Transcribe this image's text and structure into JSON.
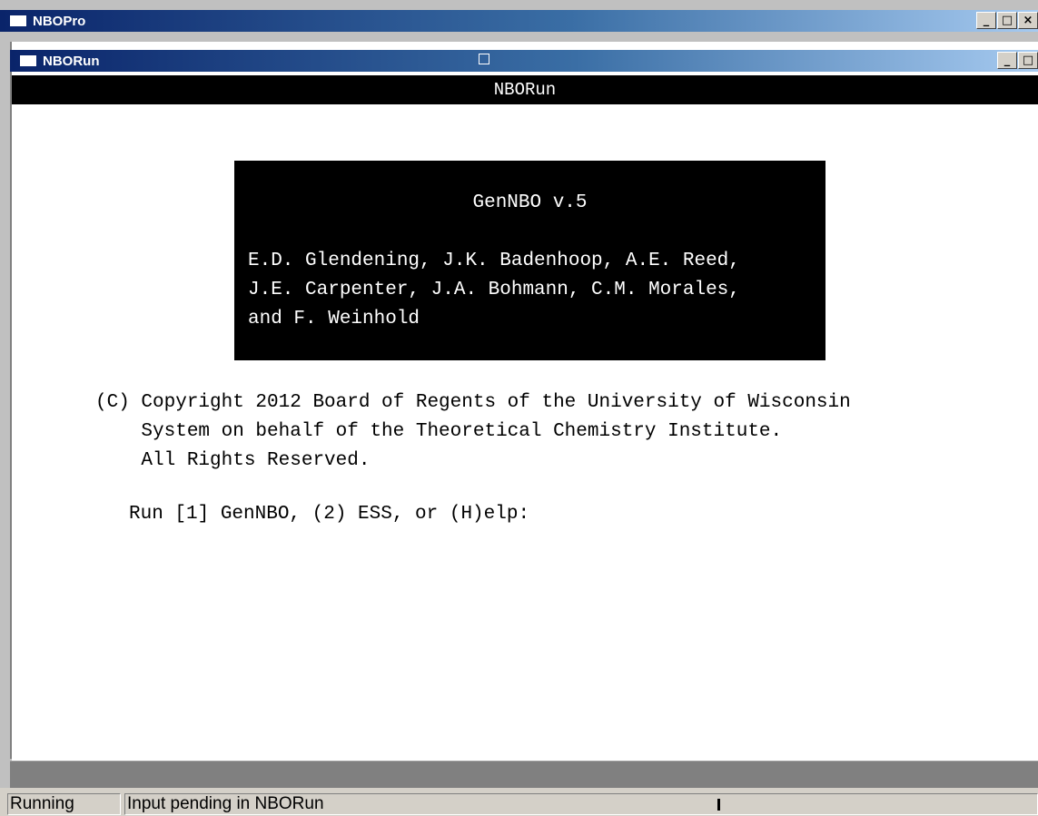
{
  "outer_window": {
    "title": "NBOPro",
    "buttons": [
      "_",
      "□",
      "×"
    ]
  },
  "inner_window": {
    "title": "NBORun",
    "buttons": [
      "_",
      "□"
    ]
  },
  "header": {
    "title": "NBORun"
  },
  "console": {
    "banner": {
      "version": "GenNBO v.5",
      "authors": "E.D. Glendening, J.K. Badenhoop, A.E. Reed,\nJ.E. Carpenter, J.A. Bohmann, C.M. Morales,\nand F. Weinhold"
    },
    "copyright": "(C) Copyright 2012 Board of Regents of the University of Wisconsin\n    System on behalf of the Theoretical Chemistry Institute.\n    All Rights Reserved.",
    "prompt": "Run [1] GenNBO, (2) ESS, or (H)elp:"
  },
  "statusbar": {
    "state": "Running",
    "message": "Input pending in NBORun"
  }
}
